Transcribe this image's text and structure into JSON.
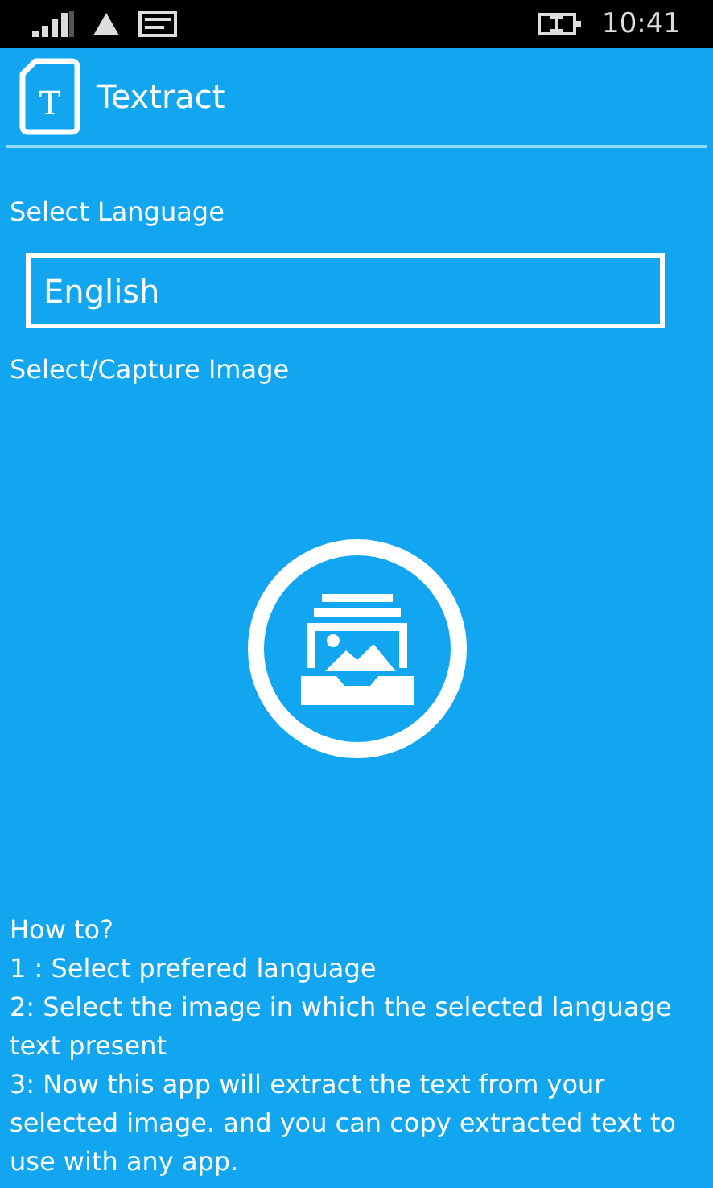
{
  "status_bar": {
    "time": "10:41"
  },
  "header": {
    "logo_letter": "T",
    "title": "Textract"
  },
  "language": {
    "label": "Select Language",
    "value": "English"
  },
  "image": {
    "label": "Select/Capture Image"
  },
  "help": [
    "How to?",
    "1 : Select prefered language",
    "2: Select the image in which the selected language text present",
    "3: Now this app will extract the text from your selected image. and you can copy extracted text to use with any app."
  ]
}
